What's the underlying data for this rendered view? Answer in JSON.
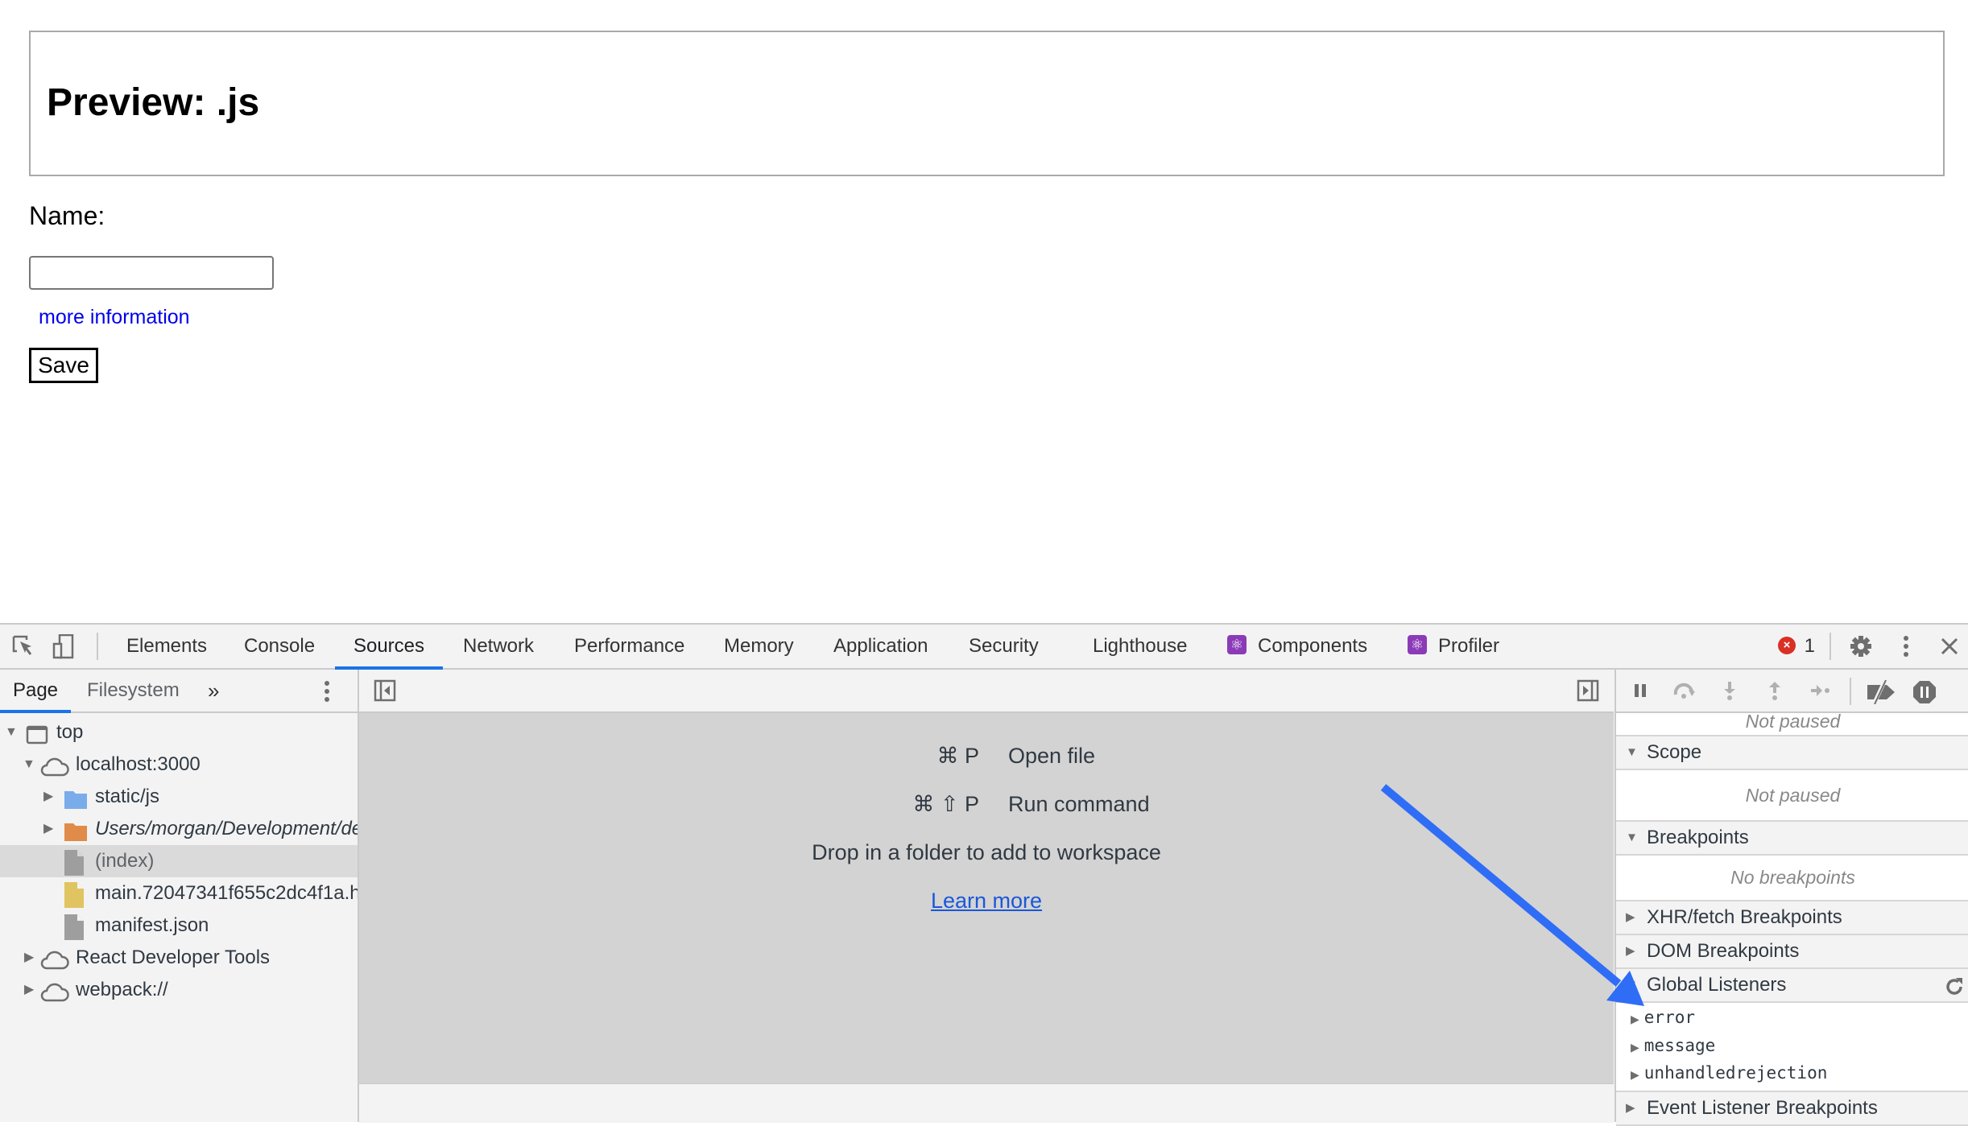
{
  "page": {
    "title": "Preview: .js",
    "name_label": "Name:",
    "name_input_value": "",
    "name_input_placeholder": "",
    "more_info_link": "more information",
    "save_button": "Save"
  },
  "devtools": {
    "toolbar": {
      "inspect_icon": "inspect-element-icon",
      "device_icon": "device-toolbar-icon",
      "tabs": [
        {
          "label": "Elements",
          "active": false
        },
        {
          "label": "Console",
          "active": false
        },
        {
          "label": "Sources",
          "active": true
        },
        {
          "label": "Network",
          "active": false
        },
        {
          "label": "Performance",
          "active": false
        },
        {
          "label": "Memory",
          "active": false
        },
        {
          "label": "Application",
          "active": false
        },
        {
          "label": "Security",
          "active": false
        },
        {
          "label": "Lighthouse",
          "active": false
        },
        {
          "label": "Components",
          "active": false,
          "icon": "react-icon"
        },
        {
          "label": "Profiler",
          "active": false,
          "icon": "react-icon"
        }
      ],
      "error_count": "1",
      "error_color": "#d93025",
      "settings_icon": "gear-icon",
      "more_icon": "kebab-menu-icon",
      "close_icon": "close-icon"
    },
    "navigator": {
      "tabs": [
        {
          "label": "Page",
          "active": true
        },
        {
          "label": "Filesystem",
          "active": false
        }
      ],
      "more_tabs": "»",
      "tree": [
        {
          "label": "top",
          "type": "frame",
          "expanded": true
        },
        {
          "label": "localhost:3000",
          "type": "domain",
          "expanded": true
        },
        {
          "label": "static/js",
          "type": "folder",
          "expanded": false,
          "color": "#7aacea"
        },
        {
          "label": "Users/morgan/Development/de",
          "type": "folder",
          "expanded": false,
          "italic": true,
          "color": "#e08b4a"
        },
        {
          "label": "(index)",
          "type": "file",
          "selected": true,
          "color": "#9e9e9e"
        },
        {
          "label": "main.72047341f655c2dc4f1a.h",
          "type": "file",
          "color": "#e0c461"
        },
        {
          "label": "manifest.json",
          "type": "file",
          "color": "#9e9e9e"
        },
        {
          "label": "React Developer Tools",
          "type": "domain",
          "expanded": false
        },
        {
          "label": "webpack://",
          "type": "domain",
          "expanded": false
        }
      ]
    },
    "editor": {
      "shortcuts": [
        {
          "keys": "⌘ P",
          "label": "Open file"
        },
        {
          "keys": "⌘ ⇧ P",
          "label": "Run command"
        }
      ],
      "drop_text": "Drop in a folder to add to workspace",
      "learn_more": "Learn more"
    },
    "debugger": {
      "call_stack_status": "Not paused",
      "sections": {
        "scope": {
          "label": "Scope",
          "expanded": true,
          "message": "Not paused"
        },
        "breakpoints": {
          "label": "Breakpoints",
          "expanded": true,
          "message": "No breakpoints"
        },
        "xhr": {
          "label": "XHR/fetch Breakpoints",
          "expanded": false
        },
        "dom": {
          "label": "DOM Breakpoints",
          "expanded": false
        },
        "global": {
          "label": "Global Listeners",
          "expanded": true,
          "listeners": [
            "error",
            "message",
            "unhandledrejection"
          ]
        },
        "event": {
          "label": "Event Listener Breakpoints",
          "expanded": false
        }
      }
    }
  },
  "annotation": {
    "arrow_color": "#2f6df6",
    "points_to": "Global Listeners"
  }
}
